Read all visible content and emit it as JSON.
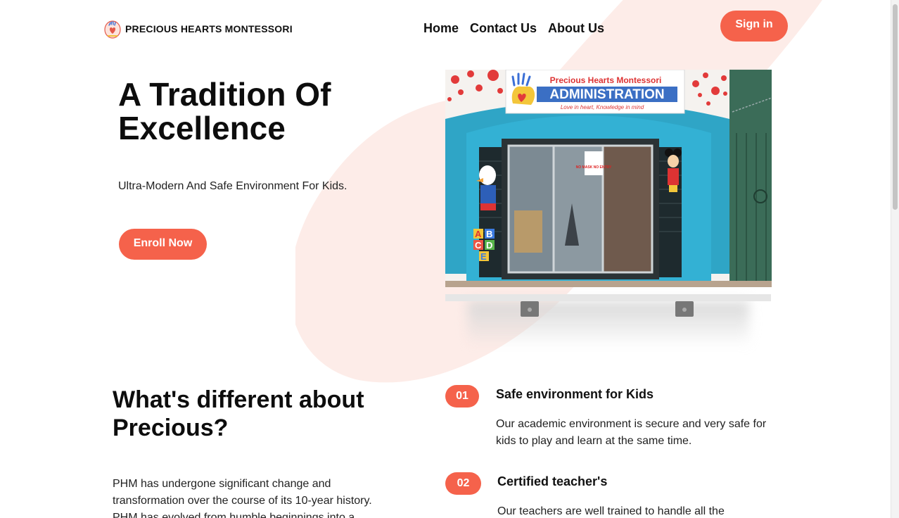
{
  "brand": {
    "name": "PRECIOUS HEARTS MONTESSORI"
  },
  "colors": {
    "accent": "#f5624b",
    "blob": "#fdece8",
    "text": "#111111"
  },
  "nav": {
    "items": [
      "Home",
      "Contact Us",
      "About Us"
    ]
  },
  "header": {
    "signin_label": "Sign in"
  },
  "hero": {
    "title_line1": "A Tradition Of",
    "title_line2": "Excellence",
    "subtitle": "Ultra-Modern And Safe Environment For Kids.",
    "cta_label": "Enroll Now"
  },
  "photo": {
    "sign_school": "Precious Hearts Montessori",
    "sign_title": "ADMINISTRATION",
    "sign_tagline": "Love in heart, Knowledge in mind",
    "notice": "NO MASK NO ENTRY",
    "blocks_text": "ABCDEF"
  },
  "about": {
    "title": "What's different about Precious?",
    "body": "PHM has undergone significant change and transformation over the course of its 10-year history. PHM has evolved from humble beginnings into a"
  },
  "features": [
    {
      "number": "01",
      "title": "Safe environment for Kids",
      "text": "Our academic environment is secure and very safe for kids to play and learn at the same time."
    },
    {
      "number": "02",
      "title": "Certified teacher's",
      "text": "Our teachers are well trained to handle all the"
    }
  ]
}
